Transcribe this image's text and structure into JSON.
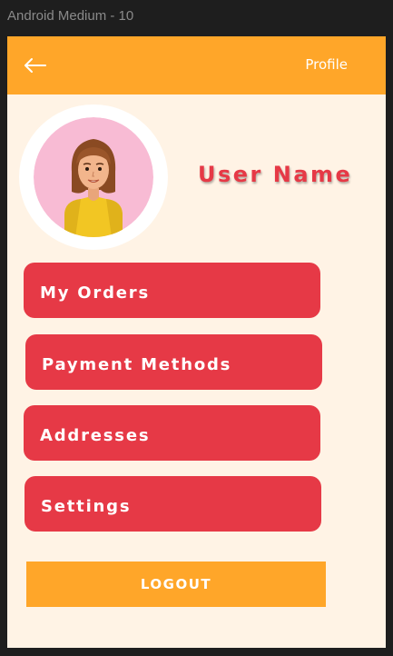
{
  "frame": {
    "title": "Android Medium - 10"
  },
  "appbar": {
    "title": "Profile",
    "back_icon": "arrow-left-icon"
  },
  "profile": {
    "user_name": "User Name",
    "avatar_icon": "woman-avatar-icon"
  },
  "menu": [
    {
      "label": "My Orders"
    },
    {
      "label": "Payment Methods"
    },
    {
      "label": "Addresses"
    },
    {
      "label": "Settings"
    }
  ],
  "logout": {
    "label": "LOGOUT"
  },
  "colors": {
    "appbar": "#ffa629",
    "background": "#fff3e5",
    "menu_button": "#e63946",
    "user_name": "#e63946",
    "logout_button": "#ffa629"
  }
}
